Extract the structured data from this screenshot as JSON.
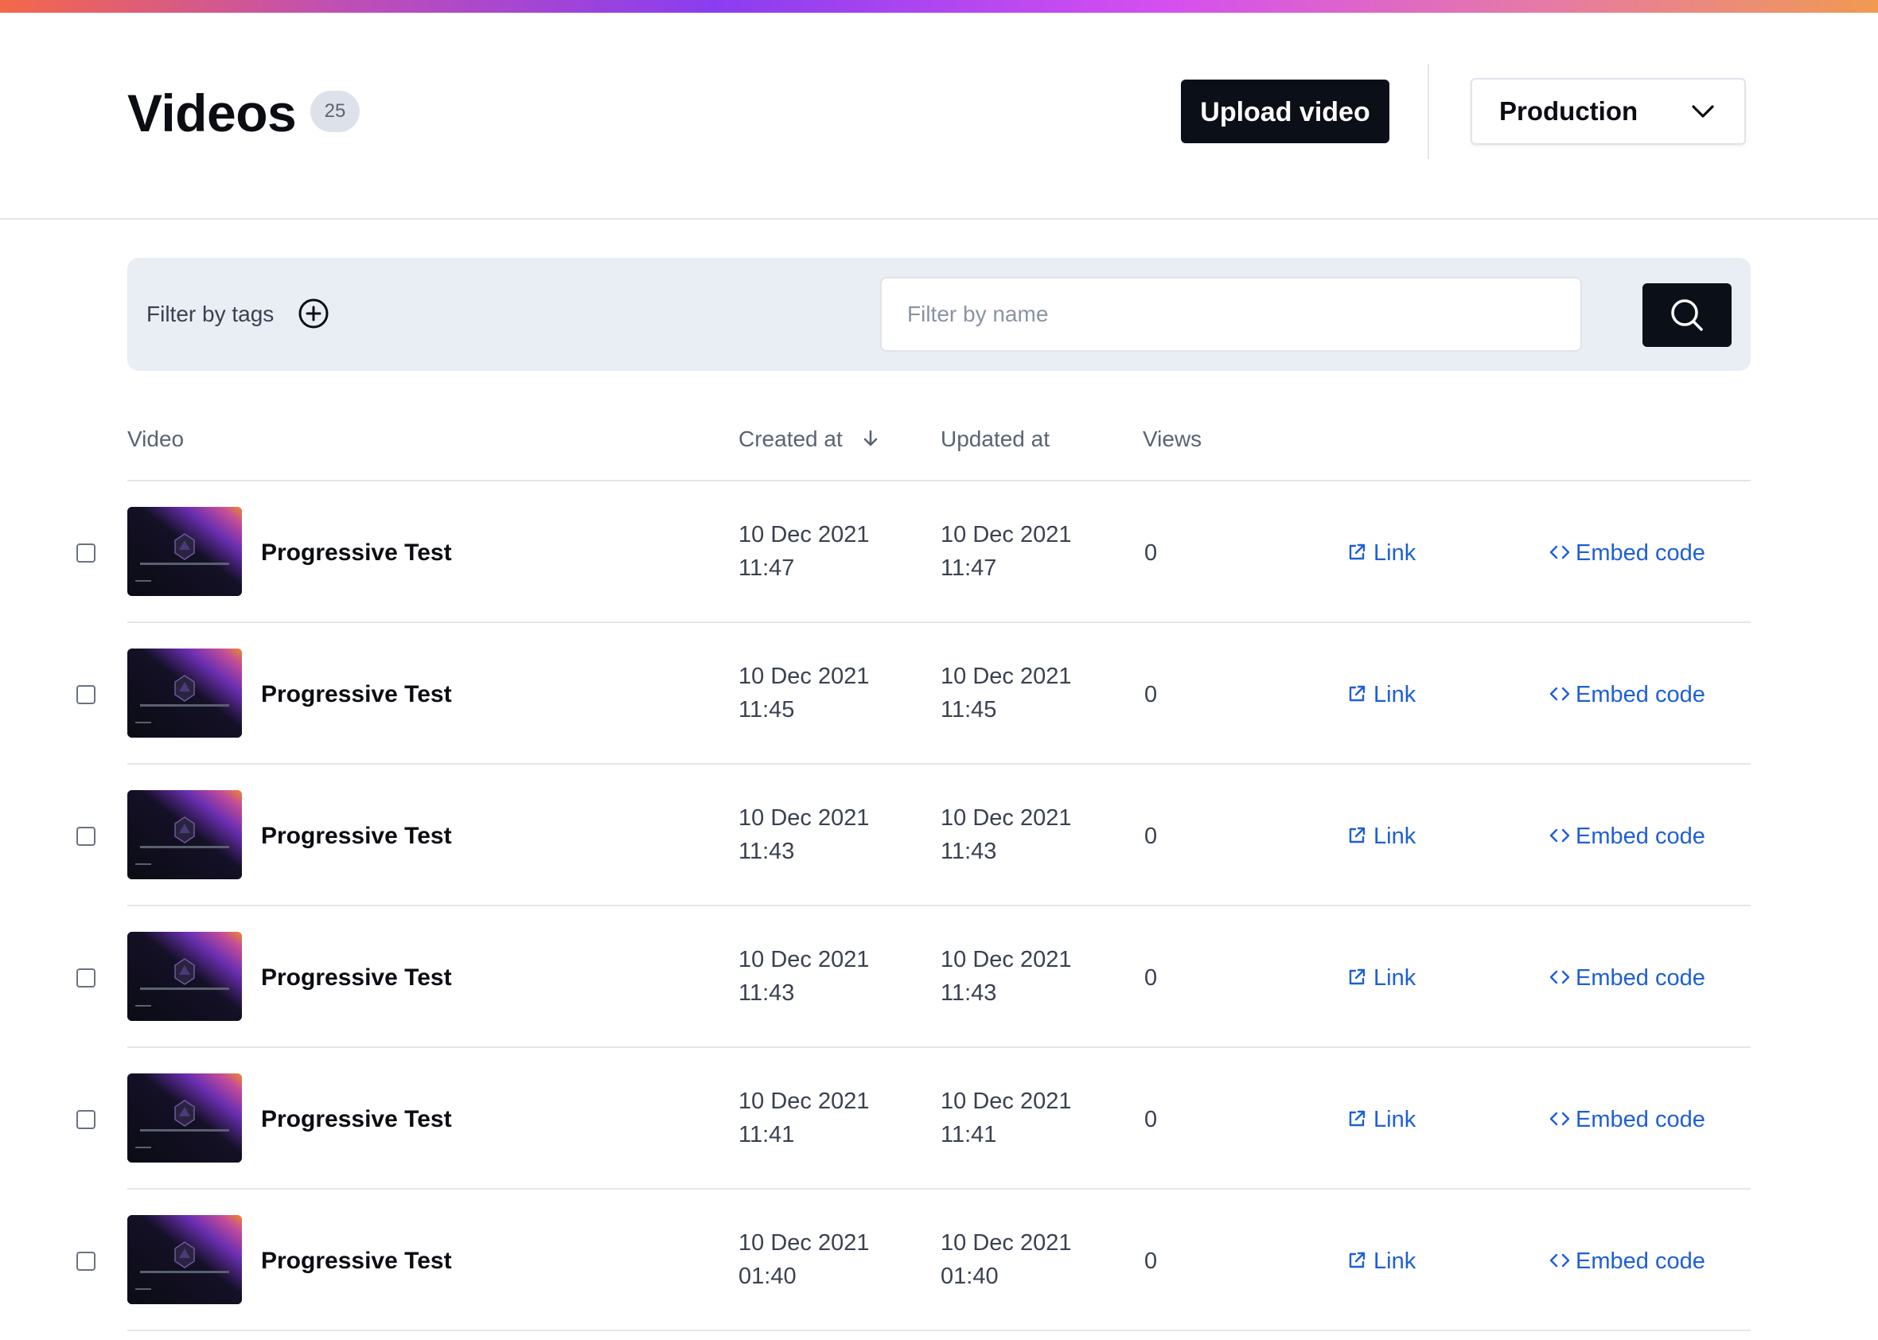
{
  "header": {
    "title": "Videos",
    "count": "25",
    "upload_label": "Upload video",
    "environment": "Production"
  },
  "filters": {
    "tags_label": "Filter by tags",
    "name_placeholder": "Filter by name"
  },
  "table": {
    "columns": {
      "video": "Video",
      "created": "Created at",
      "updated": "Updated at",
      "views": "Views"
    },
    "rows": [
      {
        "title": "Progressive Test",
        "created_date": "10 Dec 2021",
        "created_time": "11:47",
        "updated_date": "10 Dec 2021",
        "updated_time": "11:47",
        "views": "0",
        "link": "Link",
        "embed": "Embed code"
      },
      {
        "title": "Progressive Test",
        "created_date": "10 Dec 2021",
        "created_time": "11:45",
        "updated_date": "10 Dec 2021",
        "updated_time": "11:45",
        "views": "0",
        "link": "Link",
        "embed": "Embed code"
      },
      {
        "title": "Progressive Test",
        "created_date": "10 Dec 2021",
        "created_time": "11:43",
        "updated_date": "10 Dec 2021",
        "updated_time": "11:43",
        "views": "0",
        "link": "Link",
        "embed": "Embed code"
      },
      {
        "title": "Progressive Test",
        "created_date": "10 Dec 2021",
        "created_time": "11:43",
        "updated_date": "10 Dec 2021",
        "updated_time": "11:43",
        "views": "0",
        "link": "Link",
        "embed": "Embed code"
      },
      {
        "title": "Progressive Test",
        "created_date": "10 Dec 2021",
        "created_time": "11:41",
        "updated_date": "10 Dec 2021",
        "updated_time": "11:41",
        "views": "0",
        "link": "Link",
        "embed": "Embed code"
      },
      {
        "title": "Progressive Test",
        "created_date": "10 Dec 2021",
        "created_time": "01:40",
        "updated_date": "10 Dec 2021",
        "updated_time": "01:40",
        "views": "0",
        "link": "Link",
        "embed": "Embed code"
      }
    ]
  },
  "icons": {
    "add_tag": "plus-circle-icon",
    "search": "search-icon",
    "sort": "arrow-down-icon",
    "env_dropdown": "chevron-down-icon",
    "link": "external-link-icon",
    "embed": "code-icon"
  },
  "colors": {
    "primary_button": "#0b0f17",
    "link": "#1d5fd6",
    "badge_bg": "#dde2ea",
    "filter_panel": "#e9edf4"
  }
}
